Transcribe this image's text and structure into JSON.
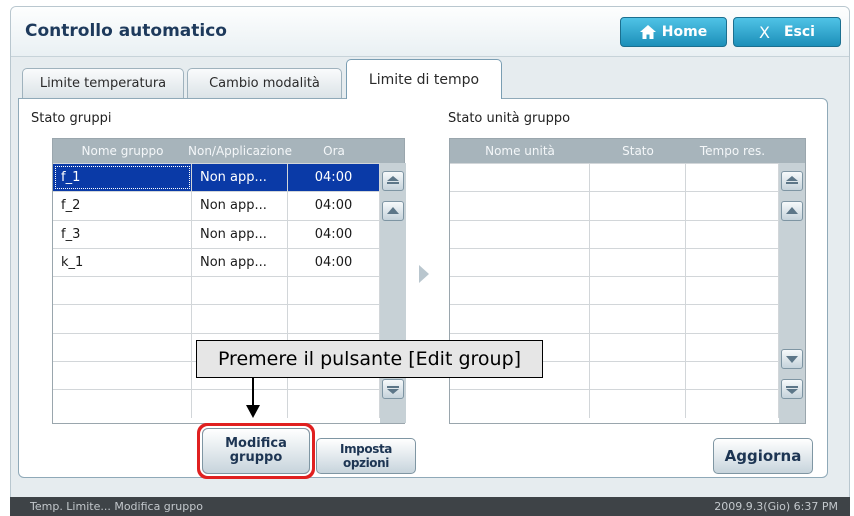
{
  "app": {
    "title": "Controllo automatico"
  },
  "header": {
    "home_label": "Home",
    "exit_label": "Esci",
    "exit_glyph": "X"
  },
  "tabs": [
    {
      "label": "Limite temperatura"
    },
    {
      "label": "Cambio modalità"
    },
    {
      "label": "Limite di tempo",
      "active": true
    }
  ],
  "groups": {
    "title": "Stato gruppi",
    "columns": [
      "Nome gruppo",
      "Non/Applicazione",
      "Ora"
    ],
    "rows": [
      {
        "name": "f_1",
        "app": "Non app...",
        "time": "04:00",
        "selected": true
      },
      {
        "name": "f_2",
        "app": "Non app...",
        "time": "04:00"
      },
      {
        "name": "f_3",
        "app": "Non app...",
        "time": "04:00"
      },
      {
        "name": "k_1",
        "app": "Non app...",
        "time": "04:00"
      }
    ]
  },
  "units": {
    "title": "Stato unità gruppo",
    "columns": [
      "Nome unità",
      "Stato",
      "Tempo res."
    ]
  },
  "callout": {
    "text": "Premere il pulsante [Edit group]"
  },
  "buttons": {
    "edit_group_line1": "Modifica",
    "edit_group_line2": "gruppo",
    "options": "Imposta opzioni",
    "refresh": "Aggiorna"
  },
  "status": {
    "left": "Temp. Limite... Modifica gruppo",
    "right": "2009.9.3(Gio) 6:37 PM"
  },
  "icons": [
    "home-icon",
    "close-icon",
    "scroll-top-icon",
    "scroll-up-icon",
    "scroll-down-icon",
    "scroll-bottom-icon",
    "transfer-arrow-icon"
  ],
  "colors": {
    "accent": "#1d8fb9",
    "selection": "#0a3aa7",
    "highlight": "#e02020",
    "status_bar": "#3e4347"
  }
}
